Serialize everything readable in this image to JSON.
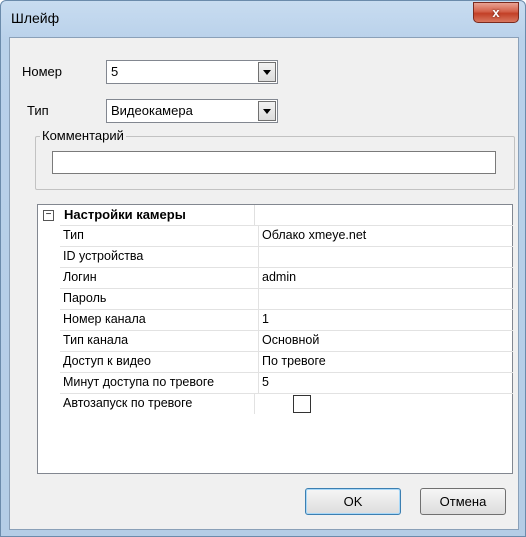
{
  "window": {
    "title": "Шлейф",
    "close_label": "x"
  },
  "form": {
    "number_label": "Номер",
    "number_value": "5",
    "type_label": "Тип",
    "type_value": "Видеокамера",
    "comment_label": "Комментарий",
    "comment_value": ""
  },
  "grid": {
    "section_toggle": "−",
    "section_title": "Настройки камеры",
    "rows": [
      {
        "name": "Тип",
        "value": "Облако xmeye.net"
      },
      {
        "name": "ID устройства",
        "value": ""
      },
      {
        "name": "Логин",
        "value": "admin"
      },
      {
        "name": "Пароль",
        "value": ""
      },
      {
        "name": "Номер канала",
        "value": "1"
      },
      {
        "name": "Тип канала",
        "value": "Основной"
      },
      {
        "name": "Доступ к видео",
        "value": "По тревоге"
      },
      {
        "name": "Минут доступа по тревоге",
        "value": "5"
      },
      {
        "name": "Автозапуск по тревоге",
        "value": "",
        "checked": false
      }
    ]
  },
  "buttons": {
    "ok": "OK",
    "cancel": "Отмена"
  },
  "colors": {
    "frame": "#b9d1ea",
    "client": "#f0f0f0",
    "close": "#c94a31"
  }
}
